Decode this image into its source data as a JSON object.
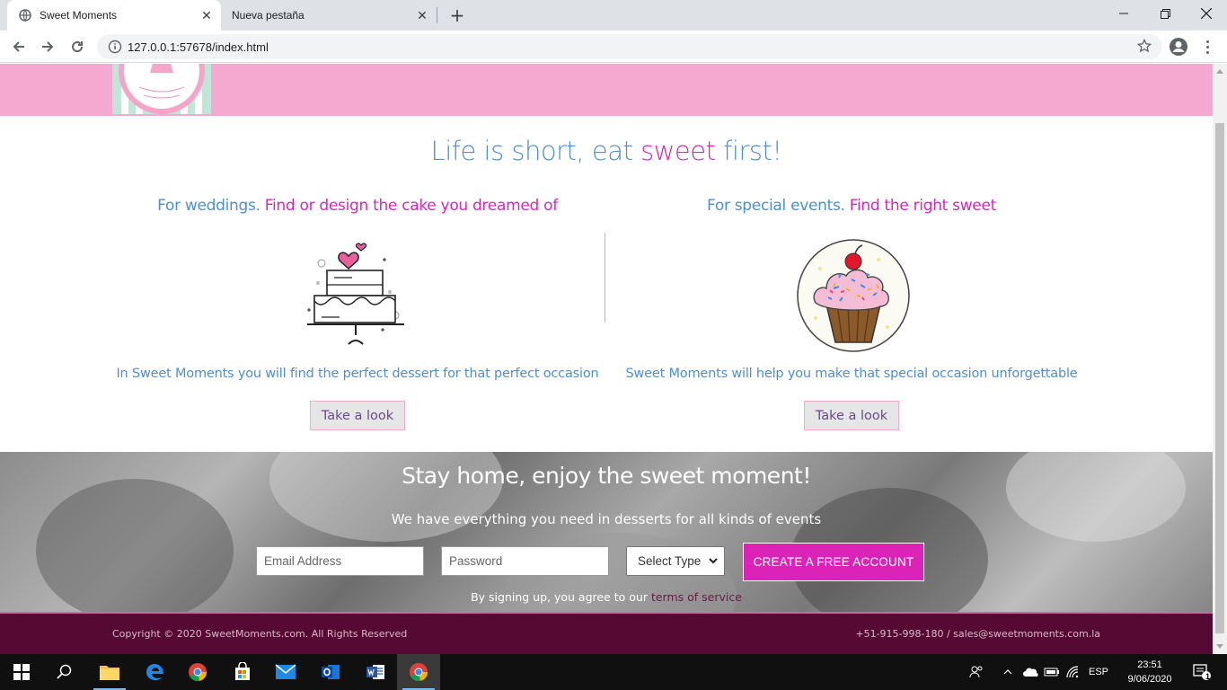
{
  "browser": {
    "tabs": [
      {
        "title": "Sweet Moments",
        "active": true
      },
      {
        "title": "Nueva pestaña",
        "active": false
      }
    ],
    "url": "127.0.0.1:57678/index.html"
  },
  "page": {
    "headline": {
      "part1": "Life is short, eat ",
      "part2": "sweet",
      "part3": " first!"
    },
    "left": {
      "heading_blue": "For weddings. ",
      "heading_pink": "Find or design the cake you dreamed of",
      "text": "In Sweet Moments you will find the perfect dessert for that perfect occasion",
      "button": "Take a look"
    },
    "right": {
      "heading_blue": "For special events. ",
      "heading_pink": "Find the right sweet",
      "text": "Sweet Moments will help you make that special occasion unforgettable",
      "button": "Take a look"
    },
    "signup": {
      "title": "Stay home, enjoy the sweet moment!",
      "subtitle": "We have everything you need in desserts for all kinds of events",
      "email_placeholder": "Email Address",
      "password_placeholder": "Password",
      "type_select": "Select Type",
      "cta": "CREATE A FREE ACCOUNT",
      "terms_prefix": "By signing up, you agree to our ",
      "terms_link": "terms of service"
    },
    "footer": {
      "copyright": "Copyright © 2020 SweetMoments.com. All Rights Reserved",
      "contact": "+51-915-998-180 / sales@sweetmoments.com.la"
    },
    "colors": {
      "pink_header": "#f5a9d0",
      "accent_pink": "#dc23b8",
      "blue_text": "#4e8fd0",
      "footer": "#560a33"
    }
  },
  "taskbar": {
    "language": "ESP",
    "time": "23:51",
    "date": "9/06/2020",
    "notifications": "1"
  }
}
